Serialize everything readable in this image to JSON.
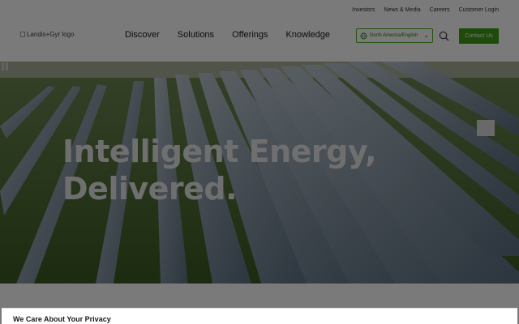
{
  "header": {
    "top_links": [
      "Investors",
      "News & Media",
      "Careers",
      "Customer Login"
    ],
    "logo_alt": "Landis+Gyr logo",
    "nav": [
      "Discover",
      "Solutions",
      "Offerings",
      "Knowledge"
    ],
    "region_label": "North America/English",
    "contact_label": "Contact Us"
  },
  "hero": {
    "title_line1": "Intelligent Energy,",
    "title_line2": "Delivered."
  },
  "privacy": {
    "title": "We Care About Your Privacy"
  },
  "colors": {
    "accent": "#3f9b16",
    "accent_border": "#4caf22"
  },
  "icons": [
    "search-icon",
    "pause-icon",
    "chevron-down-icon"
  ]
}
